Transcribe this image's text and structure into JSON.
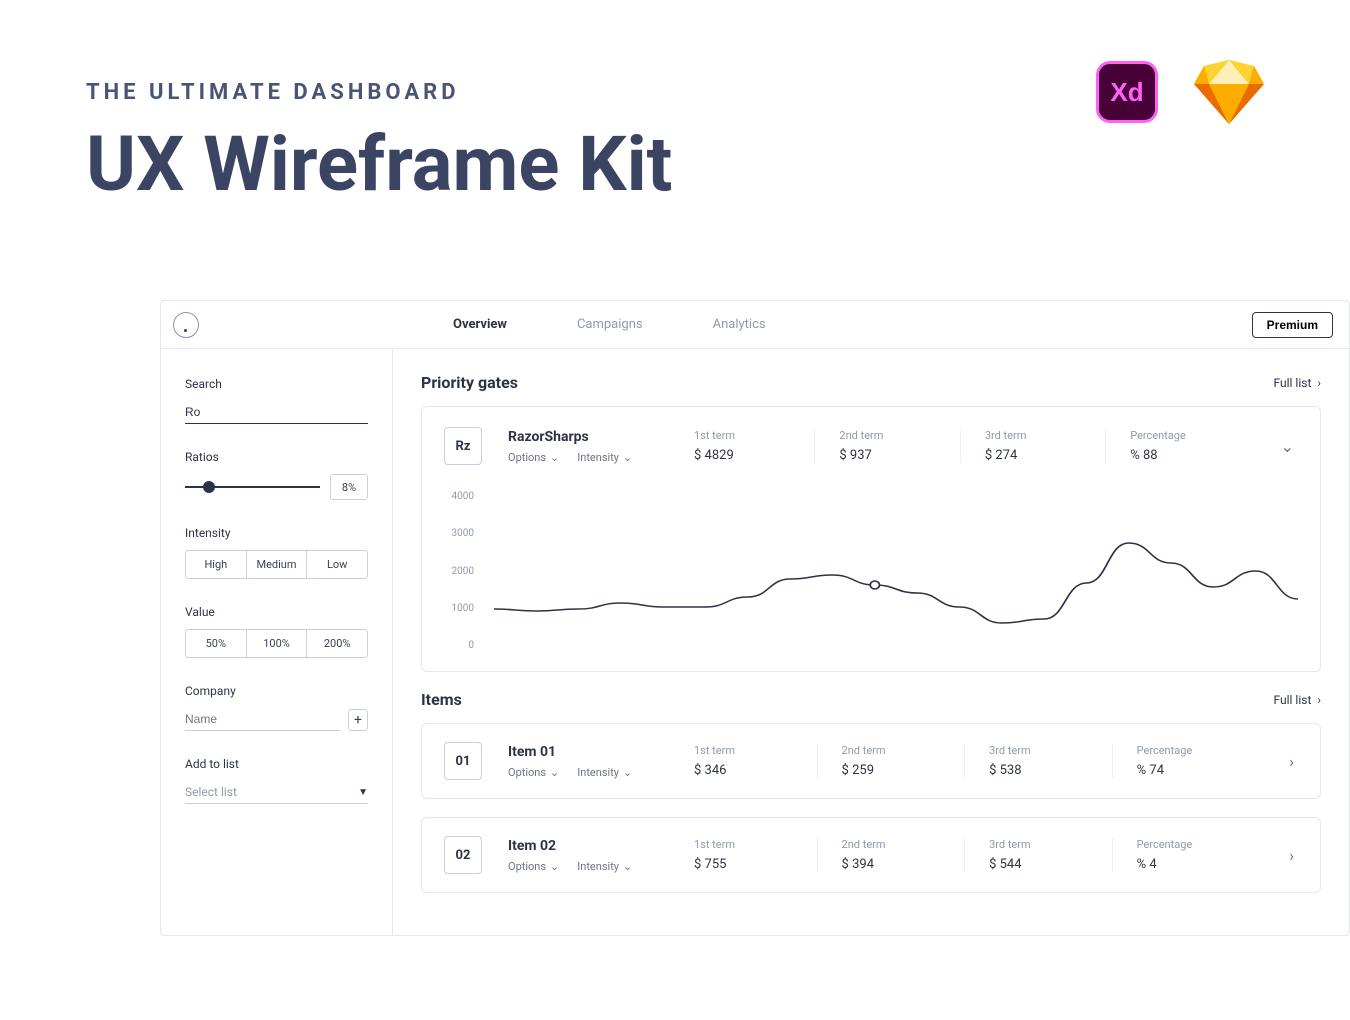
{
  "hero": {
    "eyebrow": "THE ULTIMATE DASHBOARD",
    "title": "UX Wireframe Kit",
    "xd_label": "Xd"
  },
  "topbar": {
    "tabs": [
      "Overview",
      "Campaigns",
      "Analytics"
    ],
    "active_tab": 0,
    "premium_label": "Premium"
  },
  "sidebar": {
    "search": {
      "label": "Search",
      "value": "Ro"
    },
    "ratios": {
      "label": "Ratios",
      "value": "8%"
    },
    "intensity": {
      "label": "Intensity",
      "options": [
        "High",
        "Medium",
        "Low"
      ]
    },
    "value": {
      "label": "Value",
      "options": [
        "50%",
        "100%",
        "200%"
      ]
    },
    "company": {
      "label": "Company",
      "placeholder": "Name"
    },
    "addlist": {
      "label": "Add to list",
      "placeholder": "Select list"
    }
  },
  "priority": {
    "title": "Priority gates",
    "full_list": "Full list",
    "item": {
      "badge": "Rz",
      "name": "RazorSharps",
      "options_label": "Options",
      "intensity_label": "Intensity",
      "stats": [
        {
          "label": "1st term",
          "value": "$  4829"
        },
        {
          "label": "2nd term",
          "value": "$  937"
        },
        {
          "label": "3rd term",
          "value": "$  274"
        },
        {
          "label": "Percentage",
          "value": "% 88"
        }
      ]
    }
  },
  "items_section": {
    "title": "Items",
    "full_list": "Full list",
    "rows": [
      {
        "badge": "01",
        "name": "Item 01",
        "options_label": "Options",
        "intensity_label": "Intensity",
        "stats": [
          {
            "label": "1st term",
            "value": "$  346"
          },
          {
            "label": "2nd term",
            "value": "$  259"
          },
          {
            "label": "3rd term",
            "value": "$  538"
          },
          {
            "label": "Percentage",
            "value": "% 74"
          }
        ]
      },
      {
        "badge": "02",
        "name": "Item 02",
        "options_label": "Options",
        "intensity_label": "Intensity",
        "stats": [
          {
            "label": "1st term",
            "value": "$  755"
          },
          {
            "label": "2nd term",
            "value": "$  394"
          },
          {
            "label": "3rd term",
            "value": "$  544"
          },
          {
            "label": "Percentage",
            "value": "% 4"
          }
        ]
      }
    ]
  },
  "chart_data": {
    "type": "line",
    "title": "",
    "xlabel": "",
    "ylabel": "",
    "ylim": [
      0,
      4000
    ],
    "yticks": [
      4000,
      3000,
      2000,
      1000,
      0
    ],
    "x": [
      0,
      1,
      2,
      3,
      4,
      5,
      6,
      7,
      8,
      9,
      10,
      11,
      12,
      13,
      14,
      15,
      16,
      17,
      18,
      19
    ],
    "values": [
      1050,
      1000,
      1050,
      1200,
      1100,
      1100,
      1350,
      1800,
      1900,
      1650,
      1450,
      1100,
      700,
      800,
      1700,
      2700,
      2200,
      1600,
      2000,
      1300
    ],
    "marker_index": 9
  }
}
